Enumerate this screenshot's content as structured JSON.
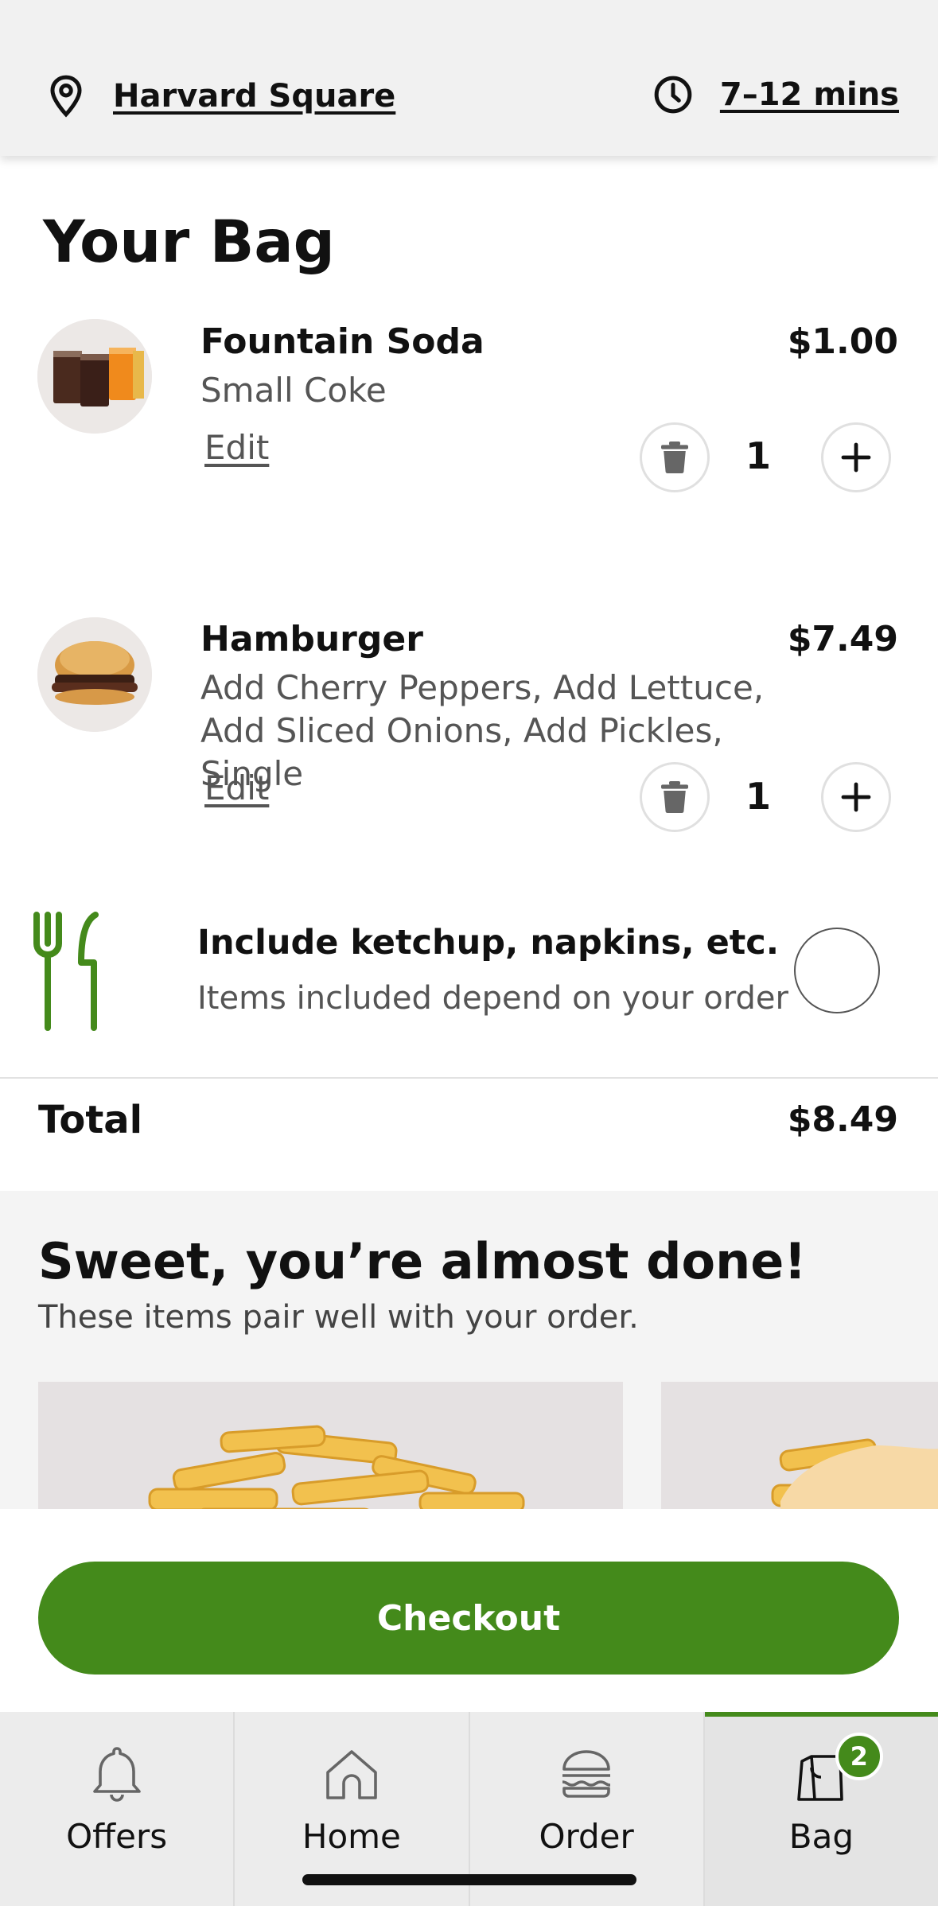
{
  "header": {
    "location": "Harvard Square",
    "location_icon": "map-pin-icon",
    "eta": "7–12 mins",
    "eta_icon": "clock-icon"
  },
  "bag": {
    "title": "Your Bag",
    "items": [
      {
        "name": "Fountain Soda",
        "description": "Small Coke",
        "price": "$1.00",
        "edit_label": "Edit",
        "quantity": "1"
      },
      {
        "name": "Hamburger",
        "description": "Add Cherry Peppers, Add Lettuce, Add Sliced Onions, Add Pickles, Single",
        "price": "$7.49",
        "edit_label": "Edit",
        "quantity": "1"
      }
    ],
    "utensils": {
      "title": "Include ketchup, napkins, etc.",
      "subtitle": "Items included depend on your order",
      "icon": "fork-knife-icon",
      "checked": false
    },
    "total_label": "Total",
    "total_value": "$8.49"
  },
  "upsell": {
    "title": "Sweet, you’re almost done!",
    "subtitle": "These items pair well with your order."
  },
  "checkout": {
    "label": "Checkout"
  },
  "tabs": [
    {
      "label": "Offers",
      "icon": "bell-icon"
    },
    {
      "label": "Home",
      "icon": "home-icon"
    },
    {
      "label": "Order",
      "icon": "burger-icon"
    },
    {
      "label": "Bag",
      "icon": "bag-icon",
      "badge": "2",
      "active": true
    }
  ],
  "colors": {
    "brand_green": "#448a1b",
    "header_bg": "#f1f1f1",
    "tabbar_bg": "#ececec",
    "upsell_bg": "#f4f4f4"
  }
}
